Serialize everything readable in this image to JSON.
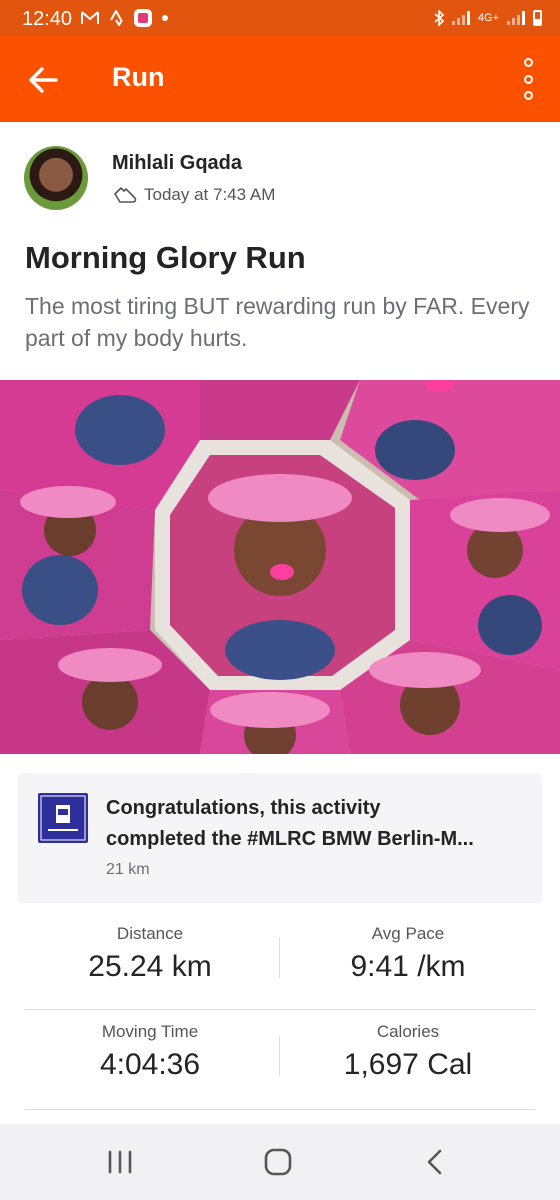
{
  "status_bar": {
    "time": "12:40",
    "icons": [
      "gmail-icon",
      "strava-icon",
      "app-notification-icon",
      "dot-icon",
      "bluetooth-icon",
      "signal-icon",
      "network-4g-icon",
      "signal-icon",
      "battery-icon"
    ],
    "network_label": "4G+"
  },
  "app_bar": {
    "title": "Run",
    "icons": [
      "back-arrow-icon",
      "more-options-icon"
    ]
  },
  "activity": {
    "athlete_name": "Mihlali Gqada",
    "timestamp": "Today at 7:43 AM",
    "title": "Morning Glory Run",
    "description": "The most tiring BUT rewarding run by FAR. Every part of my body hurts."
  },
  "challenge": {
    "line1": "Congratulations, this activity",
    "line2": "completed the #MLRC BMW Berlin-M...",
    "distance": "21 km"
  },
  "stats": [
    {
      "label": "Distance",
      "value": "25.24 km"
    },
    {
      "label": "Avg Pace",
      "value": "9:41 /km"
    },
    {
      "label": "Moving Time",
      "value": "4:04:36"
    },
    {
      "label": "Calories",
      "value": "1,697 Cal"
    }
  ],
  "colors": {
    "brand": "#fc5200",
    "status_bar": "#e2550f",
    "badge": "#2f2f9b"
  }
}
